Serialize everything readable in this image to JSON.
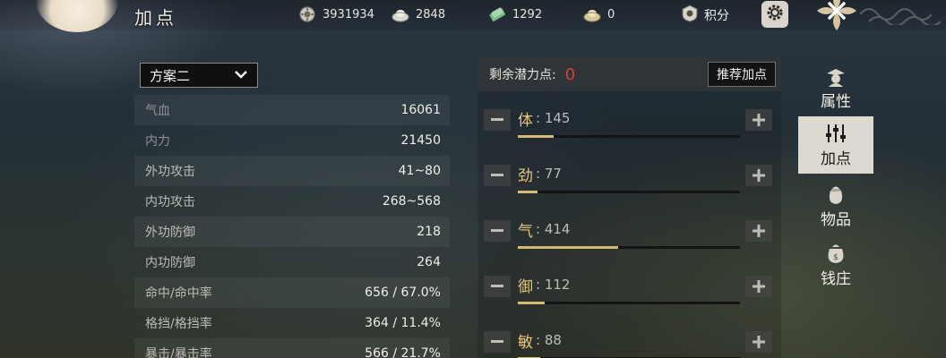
{
  "header": {
    "title": "加点"
  },
  "resources": [
    {
      "icon": "gear-coin-icon",
      "value": "3931934"
    },
    {
      "icon": "silver-ingot-icon",
      "value": "2848"
    },
    {
      "icon": "jade-note-icon",
      "value": "1292"
    },
    {
      "icon": "gold-ingot-icon",
      "value": "0"
    }
  ],
  "points": {
    "icon": "points-badge-icon",
    "label": "积分"
  },
  "plan": {
    "selected": "方案二"
  },
  "stats": [
    {
      "label": "气血",
      "value": "16061"
    },
    {
      "label": "内力",
      "value": "21450"
    },
    {
      "label": "外功攻击",
      "value": "41~80"
    },
    {
      "label": "内功攻击",
      "value": "268~568"
    },
    {
      "label": "外功防御",
      "value": "218"
    },
    {
      "label": "内功防御",
      "value": "264"
    },
    {
      "label": "命中/命中率",
      "value": "656 / 67.0%"
    },
    {
      "label": "格挡/格挡率",
      "value": "364 / 11.4%"
    },
    {
      "label": "暴击/暴击率",
      "value": "566 / 21.7%"
    }
  ],
  "allocation": {
    "remaining_label": "剩余潜力点:",
    "remaining_value": "0",
    "recommend_label": "推荐加点",
    "attributes": [
      {
        "name": "体",
        "value": ": 145",
        "level": 0.16
      },
      {
        "name": "劲",
        "value": ": 77",
        "level": 0.09
      },
      {
        "name": "气",
        "value": ": 414",
        "level": 0.45
      },
      {
        "name": "御",
        "value": ": 112",
        "level": 0.12
      },
      {
        "name": "敏",
        "value": ": 88",
        "level": 0.1
      }
    ]
  },
  "nav": [
    {
      "label": "属性",
      "icon": "character-icon",
      "active": false
    },
    {
      "label": "加点",
      "icon": "sliders-icon",
      "active": true
    },
    {
      "label": "物品",
      "icon": "bag-icon",
      "active": false
    },
    {
      "label": "钱庄",
      "icon": "money-bag-icon",
      "active": false
    }
  ],
  "colors": {
    "accent_gold": "#d6ba74",
    "remaining_red": "#e33b2e",
    "active_tab_bg": "#dcd9d1"
  }
}
